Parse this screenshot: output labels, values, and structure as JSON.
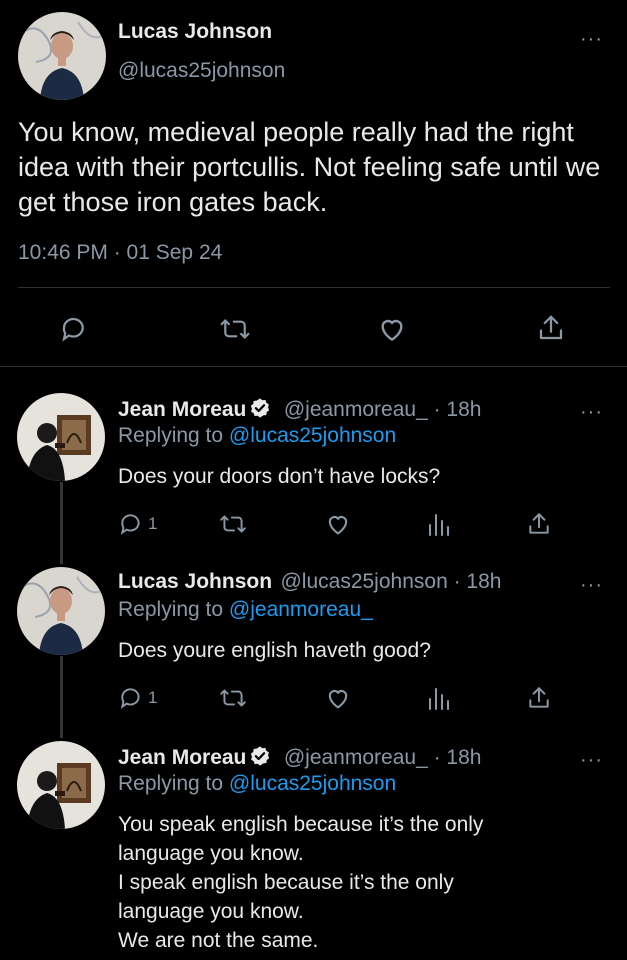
{
  "main_tweet": {
    "author_name": "Lucas Johnson",
    "handle": "@lucas25johnson",
    "text": "You know, medieval people really had the right idea with their portcullis. Not feeling safe until we get those iron gates back.",
    "timestamp": "10:46 PM · 01 Sep 24",
    "more_label": "···"
  },
  "replies": [
    {
      "author_name": "Jean Moreau",
      "handle_time": "@jeanmoreau_ · 18h",
      "replying_prefix": "Replying to",
      "replying_to": "@lucas25johnson",
      "text": "Does your doors don’t have locks?",
      "reply_count": "1",
      "verified": true
    },
    {
      "author_name": "Lucas Johnson",
      "handle_time": "@lucas25johnson · 18h",
      "replying_prefix": "Replying to",
      "replying_to": "@jeanmoreau_",
      "text": "Does youre english haveth good?",
      "reply_count": "1",
      "verified": false
    },
    {
      "author_name": "Jean Moreau",
      "handle_time": "@jeanmoreau_ · 18h",
      "replying_prefix": "Replying to",
      "replying_to": "@lucas25johnson",
      "text_lines": [
        "You speak english because it’s the only",
        "language you know.",
        "I speak english because it’s the only",
        "language you know.",
        "We are not the same."
      ],
      "verified": true
    }
  ],
  "colors": {
    "background": "#000000",
    "text": "#e7e9ea",
    "muted": "#8b98a5",
    "link": "#1d9bf0",
    "divider": "#2f3336"
  },
  "icons": [
    "reply-icon",
    "retweet-icon",
    "like-icon",
    "share-icon",
    "analytics-icon",
    "more-icon",
    "verified-icon"
  ]
}
